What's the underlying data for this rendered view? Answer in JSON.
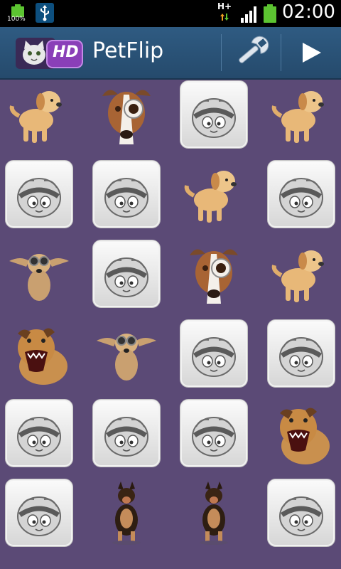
{
  "status_bar": {
    "battery_percent_label": "100%",
    "network_type": "H+",
    "time": "02:00"
  },
  "action_bar": {
    "app_logo_text": "HD",
    "title": "PetFlip",
    "settings_icon": "wrench-icon",
    "play_icon": "play-icon"
  },
  "colors": {
    "background": "#5b4a76",
    "action_bar": "#2f5b82",
    "battery": "#5cc431"
  },
  "board": {
    "columns": 4,
    "rows": 6,
    "cards": [
      {
        "state": "face-up",
        "pet": "golden-puppy"
      },
      {
        "state": "face-up",
        "pet": "monocle-dog"
      },
      {
        "state": "face-down",
        "pet": ""
      },
      {
        "state": "face-up",
        "pet": "golden-puppy"
      },
      {
        "state": "face-down",
        "pet": ""
      },
      {
        "state": "face-down",
        "pet": ""
      },
      {
        "state": "face-up",
        "pet": "golden-puppy"
      },
      {
        "state": "face-down",
        "pet": ""
      },
      {
        "state": "face-up",
        "pet": "goggles-dog"
      },
      {
        "state": "face-down",
        "pet": ""
      },
      {
        "state": "face-up",
        "pet": "monocle-dog"
      },
      {
        "state": "face-up",
        "pet": "golden-puppy"
      },
      {
        "state": "face-up",
        "pet": "barking-dog"
      },
      {
        "state": "face-up",
        "pet": "goggles-dog"
      },
      {
        "state": "face-down",
        "pet": ""
      },
      {
        "state": "face-down",
        "pet": ""
      },
      {
        "state": "face-down",
        "pet": ""
      },
      {
        "state": "face-down",
        "pet": ""
      },
      {
        "state": "face-down",
        "pet": ""
      },
      {
        "state": "face-up",
        "pet": "barking-dog"
      },
      {
        "state": "face-down",
        "pet": ""
      },
      {
        "state": "face-up",
        "pet": "shepherd-puppy"
      },
      {
        "state": "face-up",
        "pet": "shepherd-puppy"
      },
      {
        "state": "face-down",
        "pet": ""
      }
    ]
  }
}
